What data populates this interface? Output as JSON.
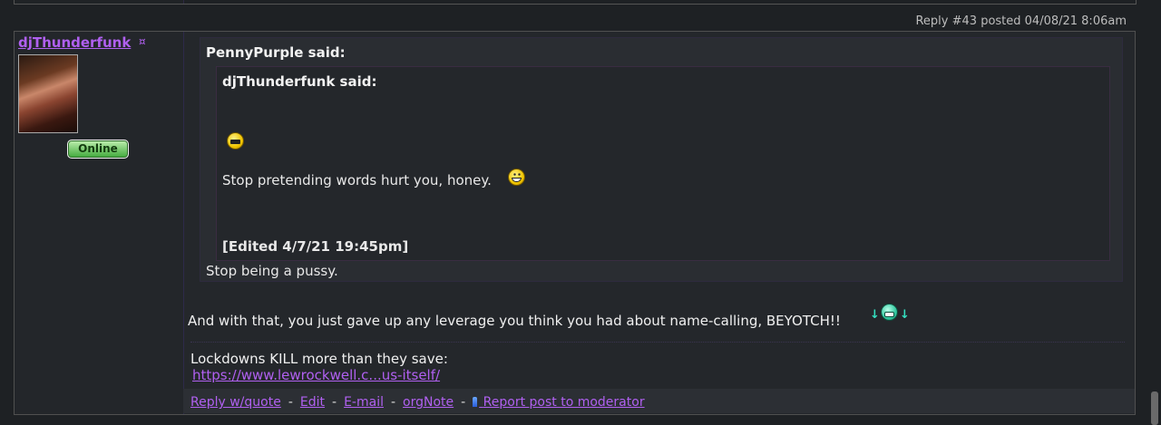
{
  "header": {
    "reply_info": "Reply #43 posted 04/08/21 8:06am"
  },
  "author": {
    "username": "djThunderfunk",
    "marker": "¤",
    "status_badge": "Online"
  },
  "quote": {
    "author_label": "PennyPurple said:",
    "inner": {
      "author_label": "djThunderfunk said:",
      "text": "Stop pretending words hurt you, honey.",
      "edited": "[Edited 4/7/21 19:45pm]"
    },
    "reply_text": "Stop being a pussy."
  },
  "body": {
    "text": "And with that, you just gave up any leverage you think you had about name-calling, BEYOTCH!!"
  },
  "signature": {
    "line": "Lockdowns KILL more than they save:",
    "link": "https://www.lewrockwell.c...us-itself/"
  },
  "footer": {
    "reply_quote": "Reply w/quote",
    "edit": "Edit",
    "email": "E-mail",
    "orgnote": "orgNote",
    "report": "Report post to moderator",
    "separator": "-"
  },
  "icons": {
    "smiley_flat": "flat-mouth-smiley-icon",
    "smiley_grin": "grinning-smiley-icon",
    "updown_emote": "updown-arrows-grin-icon",
    "report_pin": "pin-icon"
  },
  "colors": {
    "link": "#b060f0",
    "background": "#1e2124",
    "online_badge": "#3fa83a"
  }
}
